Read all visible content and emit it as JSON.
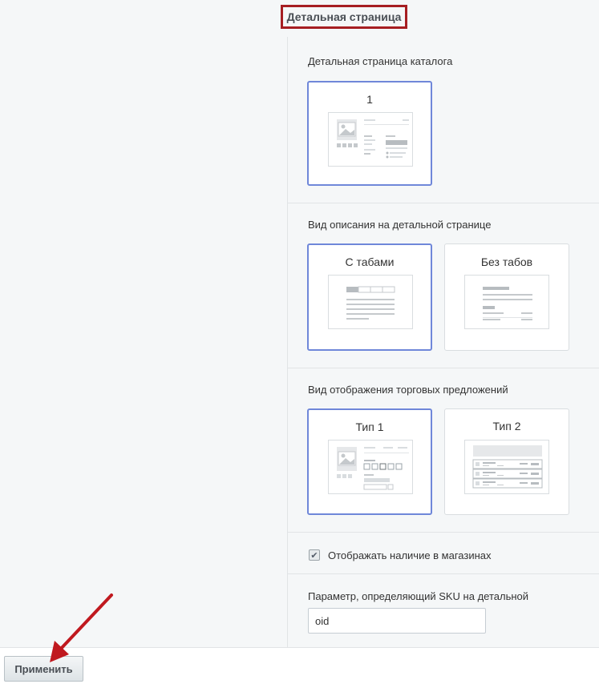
{
  "tab": {
    "title": "Детальная страница"
  },
  "sections": {
    "catalog_page": {
      "label": "Детальная страница каталога",
      "options": [
        {
          "label": "1",
          "selected": true
        }
      ]
    },
    "description_view": {
      "label": "Вид описания на детальной странице",
      "options": [
        {
          "label": "С табами",
          "selected": true
        },
        {
          "label": "Без табов",
          "selected": false
        }
      ]
    },
    "offers_view": {
      "label": "Вид отображения торговых предложений",
      "options": [
        {
          "label": "Тип 1",
          "selected": true
        },
        {
          "label": "Тип 2",
          "selected": false
        }
      ]
    }
  },
  "store_availability": {
    "label": "Отображать наличие в магазинах",
    "checked": true,
    "check_glyph": "✔"
  },
  "sku_param": {
    "label": "Параметр, определяющий SKU на детальной",
    "value": "oid"
  },
  "footer": {
    "apply_label": "Применить"
  },
  "colors": {
    "highlight_border": "#a61e22",
    "selected_border": "#6f87d9",
    "arrow": "#c0191f"
  }
}
